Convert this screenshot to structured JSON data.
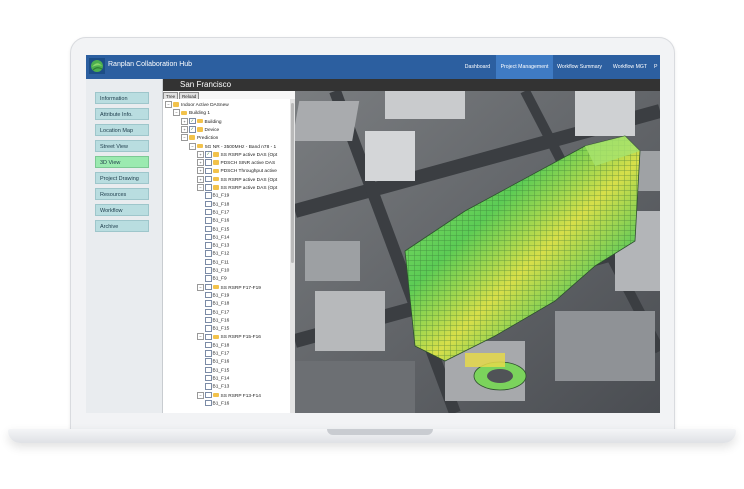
{
  "app": {
    "title": "Ranplan Collaboration Hub"
  },
  "nav": {
    "items": [
      {
        "label": "Dashboard",
        "active": false
      },
      {
        "label": "Project Management",
        "active": true
      },
      {
        "label": "Workflow Summary",
        "active": false
      },
      {
        "label": "Workflow MGT",
        "active": false
      },
      {
        "label": "P",
        "active": false
      }
    ]
  },
  "view": {
    "location": "San Francisco"
  },
  "toolbar": {
    "tree_label": "Tree",
    "reload_label": "Reload"
  },
  "sidebar": {
    "items": [
      {
        "label": "Information",
        "active": false
      },
      {
        "label": "Attribute Info.",
        "active": false
      },
      {
        "label": "Location Map",
        "active": false
      },
      {
        "label": "Street View",
        "active": false
      },
      {
        "label": "3D View",
        "active": true
      },
      {
        "label": "Project Drawing",
        "active": false
      },
      {
        "label": "Resources",
        "active": false
      },
      {
        "label": "Workflow",
        "active": false
      },
      {
        "label": "Archive",
        "active": false
      }
    ]
  },
  "tree": {
    "rows": [
      {
        "label": "Indoor Active DASnew",
        "expander": "−",
        "checkbox": false,
        "checked": false
      },
      {
        "label": "Building 1",
        "expander": "−",
        "checkbox": false,
        "checked": false
      },
      {
        "label": "Building",
        "expander": "+",
        "checkbox": true,
        "checked": true
      },
      {
        "label": "Device",
        "expander": "+",
        "checkbox": true,
        "checked": true
      },
      {
        "label": "Prediction",
        "expander": "−",
        "checkbox": false,
        "checked": false
      },
      {
        "label": "5G NR - 3500MHz - Band n78 - 1",
        "expander": "−",
        "checkbox": false,
        "checked": false
      },
      {
        "label": "SS RSRP active DAS (Opt",
        "expander": "+",
        "checkbox": true,
        "checked": true
      },
      {
        "label": "PDSCH SINR active DAS",
        "expander": "+",
        "checkbox": true,
        "checked": false
      },
      {
        "label": "PDSCH Throughput active",
        "expander": "+",
        "checkbox": true,
        "checked": false
      },
      {
        "label": "SS RSRP active DAS (Opt",
        "expander": "+",
        "checkbox": true,
        "checked": false
      },
      {
        "label": "SS RSRP active DAS (Opt",
        "expander": "−",
        "checkbox": true,
        "checked": false
      },
      {
        "label": "B1_F19",
        "expander": "",
        "checkbox": true,
        "checked": false
      },
      {
        "label": "B1_F18",
        "expander": "",
        "checkbox": true,
        "checked": false
      },
      {
        "label": "B1_F17",
        "expander": "",
        "checkbox": true,
        "checked": false
      },
      {
        "label": "B1_F16",
        "expander": "",
        "checkbox": true,
        "checked": false
      },
      {
        "label": "B1_F15",
        "expander": "",
        "checkbox": true,
        "checked": false
      },
      {
        "label": "B1_F14",
        "expander": "",
        "checkbox": true,
        "checked": false
      },
      {
        "label": "B1_F13",
        "expander": "",
        "checkbox": true,
        "checked": false
      },
      {
        "label": "B1_F12",
        "expander": "",
        "checkbox": true,
        "checked": false
      },
      {
        "label": "B1_F11",
        "expander": "",
        "checkbox": true,
        "checked": false
      },
      {
        "label": "B1_F10",
        "expander": "",
        "checkbox": true,
        "checked": false
      },
      {
        "label": "B1_F9",
        "expander": "",
        "checkbox": true,
        "checked": false
      },
      {
        "label": "SS RSRP F17-F19",
        "expander": "−",
        "checkbox": true,
        "checked": false
      },
      {
        "label": "B1_F19",
        "expander": "",
        "checkbox": true,
        "checked": false
      },
      {
        "label": "B1_F18",
        "expander": "",
        "checkbox": true,
        "checked": false
      },
      {
        "label": "B1_F17",
        "expander": "",
        "checkbox": true,
        "checked": false
      },
      {
        "label": "B1_F16",
        "expander": "",
        "checkbox": true,
        "checked": false
      },
      {
        "label": "B1_F15",
        "expander": "",
        "checkbox": true,
        "checked": false
      },
      {
        "label": "SS RSRP F15-F16",
        "expander": "−",
        "checkbox": true,
        "checked": false
      },
      {
        "label": "B1_F18",
        "expander": "",
        "checkbox": true,
        "checked": false
      },
      {
        "label": "B1_F17",
        "expander": "",
        "checkbox": true,
        "checked": false
      },
      {
        "label": "B1_F16",
        "expander": "",
        "checkbox": true,
        "checked": false
      },
      {
        "label": "B1_F15",
        "expander": "",
        "checkbox": true,
        "checked": false
      },
      {
        "label": "B1_F14",
        "expander": "",
        "checkbox": true,
        "checked": false
      },
      {
        "label": "B1_F13",
        "expander": "",
        "checkbox": true,
        "checked": false
      },
      {
        "label": "SS RSRP F13-F14",
        "expander": "−",
        "checkbox": true,
        "checked": false
      },
      {
        "label": "B1_F16",
        "expander": "",
        "checkbox": true,
        "checked": false
      }
    ]
  },
  "colors": {
    "header": "#2c5fa0",
    "nav_active": "#3f7bc4",
    "sidebar_button": "#b9dde0",
    "sidebar_active": "#9beab0",
    "coverage_good": "#6fd35a",
    "coverage_mid": "#e8d84a"
  }
}
